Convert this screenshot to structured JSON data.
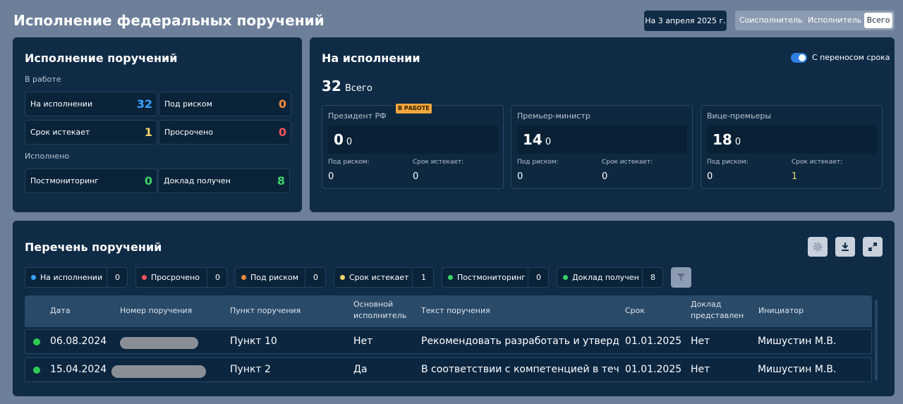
{
  "header": {
    "title": "Исполнение федеральных поручений",
    "date_label": "На 3 апреля 2025 г.",
    "segments": [
      "Соисполнитель",
      "Исполнитель",
      "Всего"
    ],
    "active_segment": "Всего"
  },
  "summary": {
    "title": "Исполнение поручений",
    "in_work_label": "В работе",
    "done_label": "Исполнено",
    "stats": [
      {
        "label": "На исполнении",
        "value": "32",
        "color": "#3aa2ff"
      },
      {
        "label": "Под риском",
        "value": "0",
        "color": "#f08a3c"
      },
      {
        "label": "Срок истекает",
        "value": "1",
        "color": "#f2d468"
      },
      {
        "label": "Просрочено",
        "value": "0",
        "color": "#f0545c"
      },
      {
        "label": "Постмониторинг",
        "value": "0",
        "color": "#3bd36a"
      },
      {
        "label": "Доклад получен",
        "value": "8",
        "color": "#3bd36a"
      }
    ]
  },
  "execution": {
    "title": "На исполнении",
    "toggle_label": "С переносом срока",
    "toggle_on": true,
    "total_value": "32",
    "total_label": "Всего",
    "cards": [
      {
        "title": "Президент РФ",
        "badge": "В РАБОТЕ",
        "main": "0",
        "secondary": "0",
        "risk_label": "Под риском:",
        "risk_value": "0",
        "expiring_label": "Срок истекает:",
        "expiring_value": "0"
      },
      {
        "title": "Премьер-министр",
        "badge": "",
        "main": "14",
        "secondary": "0",
        "risk_label": "Под риском:",
        "risk_value": "0",
        "expiring_label": "Срок истекает:",
        "expiring_value": "0"
      },
      {
        "title": "Вице-премьеры",
        "badge": "",
        "main": "18",
        "secondary": "0",
        "risk_label": "Под риском:",
        "risk_value": "0",
        "expiring_label": "Срок истекает:",
        "expiring_value": "1"
      }
    ]
  },
  "list": {
    "title": "Перечень поручений",
    "chips": [
      {
        "label": "На исполнении",
        "count": "0",
        "color": "#3aa2ff"
      },
      {
        "label": "Просрочено",
        "count": "0",
        "color": "#f0545c"
      },
      {
        "label": "Под риском",
        "count": "0",
        "color": "#f08a3c"
      },
      {
        "label": "Срок истекает",
        "count": "1",
        "color": "#f2d468"
      },
      {
        "label": "Постмониторинг",
        "count": "0",
        "color": "#3bd36a"
      },
      {
        "label": "Доклад получен",
        "count": "8",
        "color": "#3bd36a"
      }
    ],
    "columns": {
      "date": "Дата",
      "number": "Номер поручения",
      "item": "Пункт поручения",
      "executor_1": "Основной",
      "executor_2": "исполнитель",
      "text": "Текст поручения",
      "deadline": "Срок",
      "report_1": "Доклад",
      "report_2": "представлен",
      "initiator": "Инициатор"
    },
    "rows": [
      {
        "date": "06.08.2024",
        "item": "Пункт 10",
        "executor": "Нет",
        "text": "Рекомендовать разработать и утвердит...",
        "deadline": "01.01.2025",
        "report": "Нет",
        "initiator": "Мишустин М.В."
      },
      {
        "date": "15.04.2024",
        "item": "Пункт 2",
        "executor": "Да",
        "text": "В соответствии с компетенцией в течен...",
        "deadline": "01.01.2025",
        "report": "Нет",
        "initiator": "Мишустин М.В."
      }
    ]
  }
}
